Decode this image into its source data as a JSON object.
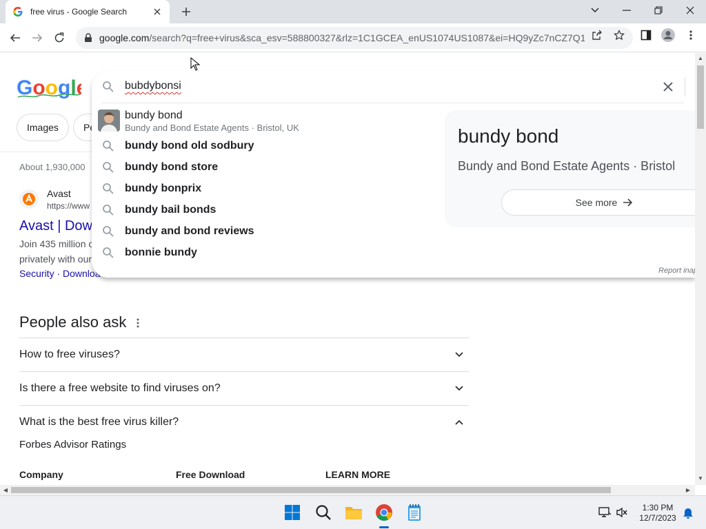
{
  "browser": {
    "tab_title": "free virus - Google Search",
    "url_host": "google.com",
    "url_rest": "/search?q=free+virus&sca_esv=588800327&rlz=1C1GCEA_enUS1074US1087&ei=HQ9yZc7nCZ7Q1s..."
  },
  "search": {
    "query": "bubdybonsi"
  },
  "filters": {
    "images": "Images",
    "partial": "Pe"
  },
  "suggestions": {
    "rich": {
      "title": "bundy bond",
      "subtitle": "Bundy and Bond Estate Agents · Bristol, UK"
    },
    "items": [
      "bundy bond old sodbury",
      "bundy bond store",
      "bundy bonprix",
      "bundy bail bonds",
      "bundy and bond reviews",
      "bonnie bundy"
    ],
    "report": "Report inap"
  },
  "knowledge_panel": {
    "title": "bundy bond",
    "subtitle": "Bundy and Bond Estate Agents · Bristol",
    "button": "See more"
  },
  "results": {
    "about": "About 1,930,000",
    "site_name": "Avast",
    "site_url": "https://www",
    "title": "Avast | Dow",
    "snippet_line1": "Join 435 million c",
    "snippet_line2": "privately with our",
    "links": "Security · Downloa"
  },
  "people_also_ask": {
    "heading": "People also ask",
    "questions": [
      "How to free viruses?",
      "Is there a free website to find viruses on?",
      "What is the best free virus killer?"
    ],
    "expanded_source": "Forbes Advisor Ratings",
    "table_headers": [
      "Company",
      "Free Download",
      "LEARN MORE"
    ]
  },
  "taskbar": {
    "time": "1:30 PM",
    "date": "12/7/2023"
  },
  "colors": {
    "link": "#1a0dab",
    "chrome_bg": "#dee1e6",
    "accent_blue": "#4285f4"
  }
}
